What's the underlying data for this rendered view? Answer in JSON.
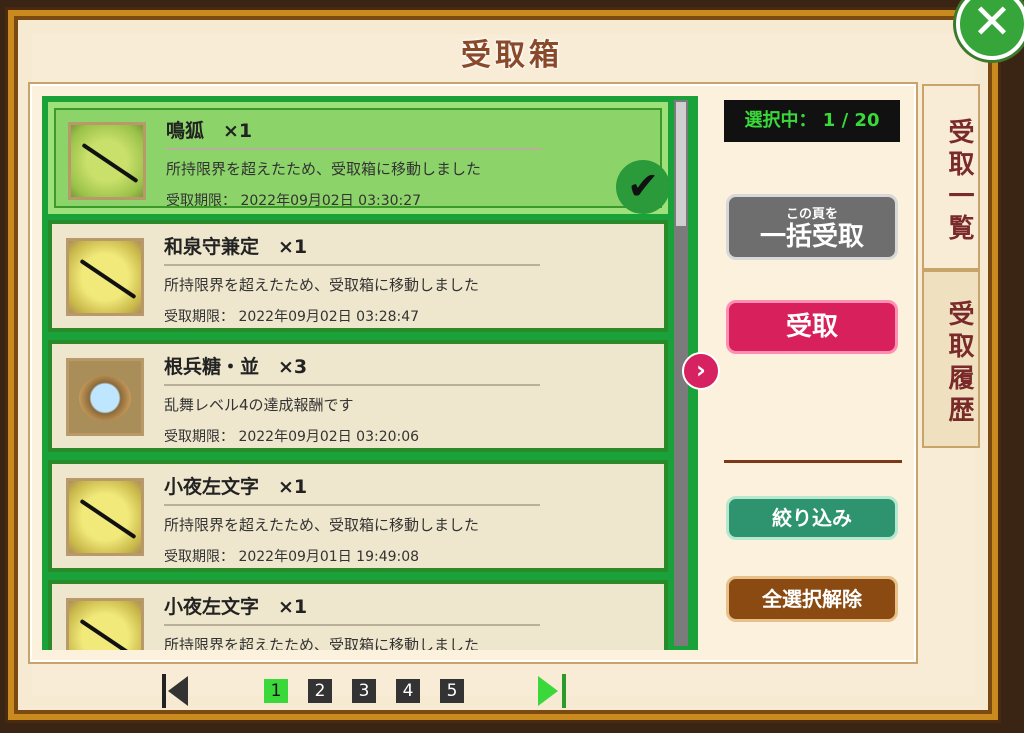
{
  "title": "受取箱",
  "counter": "選択中： 1 / 20",
  "items": [
    {
      "name": "鳴狐　×1",
      "message": "所持限界を超えたため、受取箱に移動しました",
      "expiry": "受取期限： 2022年09月02日 03:30:27",
      "selected": true,
      "icon": "sword-icon"
    },
    {
      "name": "和泉守兼定　×1",
      "message": "所持限界を超えたため、受取箱に移動しました",
      "expiry": "受取期限： 2022年09月02日 03:28:47",
      "selected": false,
      "icon": "sword-icon"
    },
    {
      "name": "根兵糖・並　×3",
      "message": "乱舞レベル4の達成報酬です",
      "expiry": "受取期限： 2022年09月02日 03:20:06",
      "selected": false,
      "icon": "candy-bowl-icon"
    },
    {
      "name": "小夜左文字　×1",
      "message": "所持限界を超えたため、受取箱に移動しました",
      "expiry": "受取期限： 2022年09月01日 19:49:08",
      "selected": false,
      "icon": "sword-icon"
    },
    {
      "name": "小夜左文字　×1",
      "message": "所持限界を超えたため、受取箱に移動しました",
      "expiry": "",
      "selected": false,
      "icon": "sword-icon"
    }
  ],
  "buttons": {
    "bulk_small": "この頁を",
    "bulk_big": "一括受取",
    "receive": "受取",
    "filter": "絞り込み",
    "clear_all": "全選択解除"
  },
  "tabs": {
    "list": "受取一覧",
    "history": "受取履歴"
  },
  "pager": {
    "pages": [
      "1",
      "2",
      "3",
      "4",
      "5"
    ],
    "current": "1"
  },
  "colors": {
    "accent_green": "#3ad83a",
    "receive_pink": "#d8205c",
    "filter_teal": "#2e9470",
    "clear_brown": "#8a4a12"
  }
}
